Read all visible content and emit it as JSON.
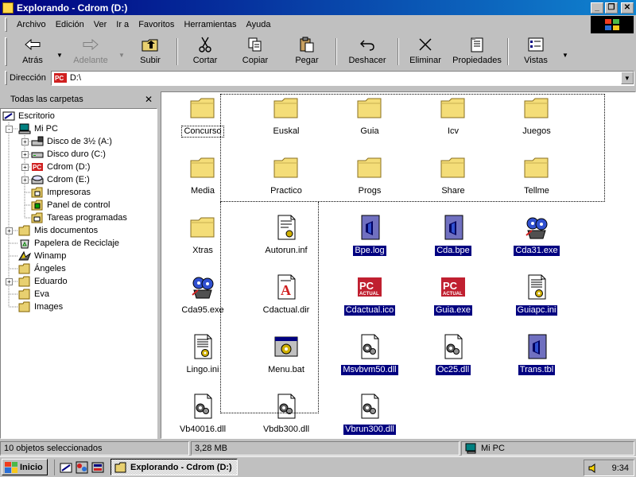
{
  "window": {
    "title": "Explorando - Cdrom (D:)"
  },
  "menu": [
    "Archivo",
    "Edición",
    "Ver",
    "Ir a",
    "Favoritos",
    "Herramientas",
    "Ayuda"
  ],
  "toolbar": {
    "back": "Atrás",
    "forward": "Adelante",
    "up": "Subir",
    "cut": "Cortar",
    "copy": "Copiar",
    "paste": "Pegar",
    "undo": "Deshacer",
    "delete": "Eliminar",
    "properties": "Propiedades",
    "views": "Vistas"
  },
  "address": {
    "label": "Dirección",
    "value": "D:\\"
  },
  "tree": {
    "title": "Todas las carpetas",
    "items": [
      {
        "label": "Escritorio",
        "icon": "desktop-icon"
      },
      {
        "label": "Mi PC",
        "icon": "computer-icon"
      },
      {
        "label": "Disco de 3½ (A:)",
        "icon": "floppy-icon"
      },
      {
        "label": "Disco duro (C:)",
        "icon": "harddisk-icon"
      },
      {
        "label": "Cdrom (D:)",
        "icon": "cdrom-pc-icon"
      },
      {
        "label": "Cdrom (E:)",
        "icon": "cdrom-icon"
      },
      {
        "label": "Impresoras",
        "icon": "printer-folder-icon"
      },
      {
        "label": "Panel de control",
        "icon": "control-panel-icon"
      },
      {
        "label": "Tareas programadas",
        "icon": "scheduled-tasks-icon"
      },
      {
        "label": "Mis documentos",
        "icon": "folder-icon"
      },
      {
        "label": "Papelera de Reciclaje",
        "icon": "recycle-bin-icon"
      },
      {
        "label": "Winamp",
        "icon": "winamp-icon"
      },
      {
        "label": "Ángeles",
        "icon": "folder-icon"
      },
      {
        "label": "Eduardo",
        "icon": "folder-icon"
      },
      {
        "label": "Eva",
        "icon": "folder-icon"
      },
      {
        "label": "Images",
        "icon": "folder-icon"
      }
    ]
  },
  "files": [
    {
      "name": "Concurso",
      "icon": "folder"
    },
    {
      "name": "Euskal",
      "icon": "folder"
    },
    {
      "name": "Guia",
      "icon": "folder"
    },
    {
      "name": "Icv",
      "icon": "folder"
    },
    {
      "name": "Juegos",
      "icon": "folder"
    },
    {
      "name": "Media",
      "icon": "folder"
    },
    {
      "name": "Practico",
      "icon": "folder"
    },
    {
      "name": "Progs",
      "icon": "folder"
    },
    {
      "name": "Share",
      "icon": "folder"
    },
    {
      "name": "Tellme",
      "icon": "folder"
    },
    {
      "name": "Xtras",
      "icon": "folder"
    },
    {
      "name": "Autorun.inf",
      "icon": "inf"
    },
    {
      "name": "Bpe.log",
      "icon": "log",
      "selected": true
    },
    {
      "name": "Cda.bpe",
      "icon": "log",
      "selected": true
    },
    {
      "name": "Cda31.exe",
      "icon": "exe-reels",
      "selected": true
    },
    {
      "name": "Cda95.exe",
      "icon": "exe-reels"
    },
    {
      "name": "Cdactual.dir",
      "icon": "dir"
    },
    {
      "name": "Cdactual.ico",
      "icon": "pc-actual",
      "selected": true
    },
    {
      "name": "Guia.exe",
      "icon": "pc-actual",
      "selected": true
    },
    {
      "name": "Guiapc.ini",
      "icon": "ini",
      "selected": true
    },
    {
      "name": "Lingo.ini",
      "icon": "ini"
    },
    {
      "name": "Menu.bat",
      "icon": "bat"
    },
    {
      "name": "Msvbvm50.dll",
      "icon": "dll",
      "selected": true
    },
    {
      "name": "Oc25.dll",
      "icon": "dll",
      "selected": true
    },
    {
      "name": "Trans.tbl",
      "icon": "log",
      "selected": true
    },
    {
      "name": "Vb40016.dll",
      "icon": "dll"
    },
    {
      "name": "Vbdb300.dll",
      "icon": "dll"
    },
    {
      "name": "Vbrun300.dll",
      "icon": "dll",
      "selected": true
    }
  ],
  "status": {
    "count": "10 objetos seleccionados",
    "size": "3,28 MB",
    "location": "Mi PC"
  },
  "taskbar": {
    "start": "Inicio",
    "task": "Explorando - Cdrom (D:)",
    "time": "9:34"
  }
}
